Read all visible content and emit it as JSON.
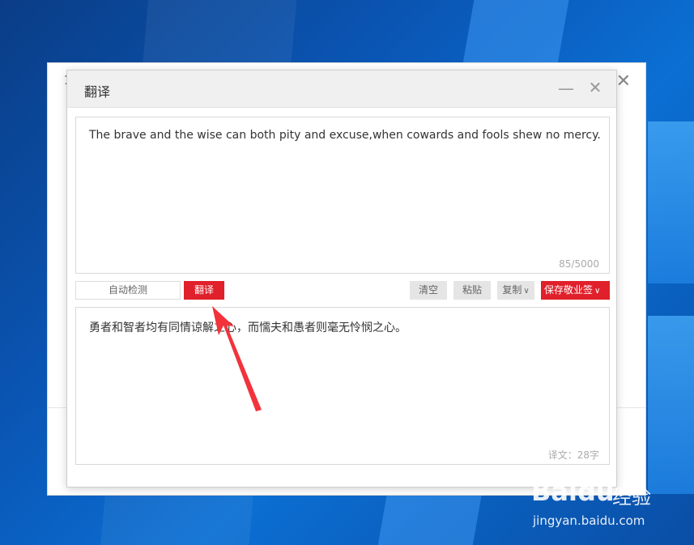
{
  "back_window": {
    "title_char": "1",
    "close_glyph": "✕"
  },
  "dialog": {
    "title": "翻译",
    "minimize_glyph": "—",
    "close_glyph": "✕"
  },
  "source": {
    "text": "The brave and the wise can both pity and excuse,when cowards and fools shew no mercy.",
    "char_count": "85/5000"
  },
  "toolbar": {
    "language": "自动检测",
    "translate_label": "翻译",
    "clear_label": "清空",
    "paste_label": "粘贴",
    "copy_label": "复制",
    "save_label": "保存敬业签",
    "caret": "∨"
  },
  "result": {
    "text": "勇者和智者均有同情谅解之心，而懦夫和愚者则毫无怜悯之心。",
    "count": "译文：28字"
  },
  "watermark": {
    "logo": "Baidu",
    "cn": "经验",
    "url": "jingyan.baidu.com"
  },
  "colors": {
    "accent": "#e0202b",
    "desktop": "#0b5fc4"
  }
}
